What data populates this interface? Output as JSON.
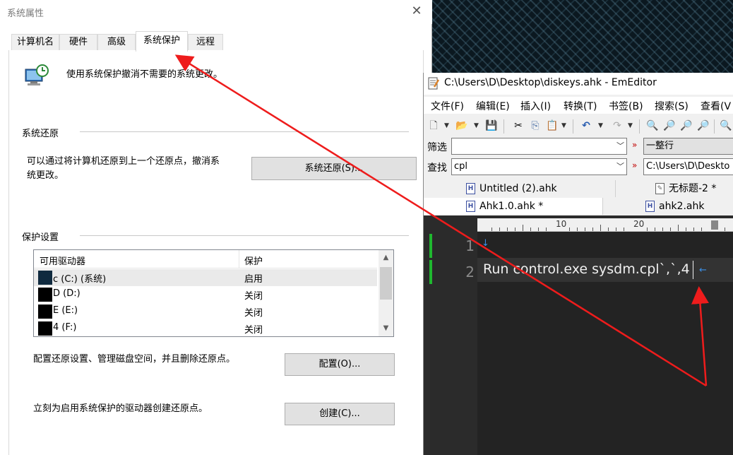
{
  "sysprops": {
    "title": "系统属性",
    "close": "✕",
    "tabs": [
      "计算机名",
      "硬件",
      "高级",
      "系统保护",
      "远程"
    ],
    "active_tab": "系统保护",
    "description": "使用系统保护撤消不需要的系统更改。",
    "restore": {
      "group_title": "系统还原",
      "text_line1": "可以通过将计算机还原到上一个还原点，撤消系",
      "text_line2": "统更改。",
      "button": "系统还原(S)..."
    },
    "protection": {
      "group_title": "保护设置",
      "col_drive": "可用驱动器",
      "col_protect": "保护",
      "drives": [
        {
          "name": "c (C:) (系统)",
          "state": "启用"
        },
        {
          "name": "D (D:)",
          "state": "关闭"
        },
        {
          "name": "E (E:)",
          "state": "关闭"
        },
        {
          "name": "4 (F:)",
          "state": "关闭"
        }
      ],
      "configure_text": "配置还原设置、管理磁盘空间，并且删除还原点。",
      "configure_button": "配置(O)...",
      "create_text": "立刻为启用系统保护的驱动器创建还原点。",
      "create_button": "创建(C)..."
    }
  },
  "emeditor": {
    "title": "C:\\Users\\D\\Desktop\\diskeys.ahk - EmEditor",
    "menu": [
      "文件(F)",
      "编辑(E)",
      "插入(I)",
      "转换(T)",
      "书签(B)",
      "搜索(S)",
      "查看(V"
    ],
    "filter_label": "筛选",
    "filter_value": "",
    "filter_mode": "一整行",
    "find_label": "查找",
    "find_value": "cpl",
    "find_path": "C:\\Users\\D\\Deskto",
    "dbl_arrow": "»",
    "tabs_row1": [
      "Untitled (2).ahk",
      "无标题-2 *"
    ],
    "tabs_row2": [
      "Ahk1.0.ahk *",
      "ahk2.ahk"
    ],
    "ruler": [
      "10",
      "20"
    ],
    "line_numbers": [
      "1",
      "2"
    ],
    "code_line2": "Run control.exe sysdm.cpl`,`,4"
  }
}
